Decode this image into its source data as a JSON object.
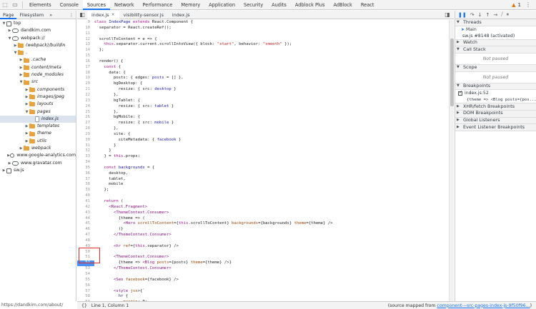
{
  "topbar": {
    "tabs": [
      "Elements",
      "Console",
      "Sources",
      "Network",
      "Performance",
      "Memory",
      "Application",
      "Security",
      "Audits",
      "Adblock Plus",
      "AdBlock",
      "React"
    ],
    "active_tab": "Sources",
    "warning_count": "1"
  },
  "navigator": {
    "tabs": [
      "Page",
      "Filesystem",
      "»"
    ],
    "tree": [
      {
        "label": "top",
        "depth": 0,
        "icon": "square",
        "expanded": true
      },
      {
        "label": "dandkim.com",
        "depth": 1,
        "icon": "cloud",
        "expanded": false
      },
      {
        "label": "webpack://",
        "depth": 1,
        "icon": "cloud",
        "expanded": true
      },
      {
        "label": "(webpack)/buildin",
        "depth": 2,
        "icon": "folder",
        "expanded": false,
        "italic": true
      },
      {
        "label": ".",
        "depth": 2,
        "icon": "folder",
        "expanded": true
      },
      {
        "label": ".cache",
        "depth": 3,
        "icon": "folder",
        "expanded": false,
        "italic": true
      },
      {
        "label": "content/meta",
        "depth": 3,
        "icon": "folder",
        "expanded": false,
        "italic": true
      },
      {
        "label": "node_modules",
        "depth": 3,
        "icon": "folder",
        "expanded": false,
        "italic": true
      },
      {
        "label": "src",
        "depth": 3,
        "icon": "folder",
        "expanded": true,
        "italic": true
      },
      {
        "label": "components",
        "depth": 4,
        "icon": "folder",
        "expanded": false,
        "italic": true
      },
      {
        "label": "images/jpeg",
        "depth": 4,
        "icon": "folder",
        "expanded": false,
        "italic": true
      },
      {
        "label": "layouts",
        "depth": 4,
        "icon": "folder",
        "expanded": false,
        "italic": true
      },
      {
        "label": "pages",
        "depth": 4,
        "icon": "folder",
        "expanded": true,
        "italic": true
      },
      {
        "label": "index.js",
        "depth": 5,
        "icon": "file",
        "selected": true,
        "italic": true
      },
      {
        "label": "templates",
        "depth": 4,
        "icon": "folder",
        "expanded": false,
        "italic": true
      },
      {
        "label": "theme",
        "depth": 4,
        "icon": "folder",
        "expanded": false,
        "italic": true
      },
      {
        "label": "utils",
        "depth": 4,
        "icon": "folder",
        "expanded": false,
        "italic": true
      },
      {
        "label": "webpack",
        "depth": 3,
        "icon": "folder",
        "expanded": false,
        "italic": true
      },
      {
        "label": "www.google-analytics.com",
        "depth": 1,
        "icon": "cloud",
        "expanded": false
      },
      {
        "label": "www.gravatar.com",
        "depth": 1,
        "icon": "cloud",
        "expanded": false
      },
      {
        "label": "sw.js",
        "depth": 0,
        "icon": "square",
        "expanded": false
      }
    ],
    "status_url": "https://dandkim.com/about/"
  },
  "editor": {
    "tabs": [
      {
        "label": "index.js",
        "active": true
      },
      {
        "label": "visibility-sensor.js",
        "active": false
      },
      {
        "label": "index.js",
        "active": false
      }
    ],
    "lines": [
      {
        "n": "9",
        "segs": [
          [
            "kw",
            "class "
          ],
          [
            "ty",
            "IndexPage "
          ],
          [
            "kw",
            "extends "
          ],
          [
            "ct",
            "React.Component {"
          ]
        ]
      },
      {
        "n": "10",
        "segs": [
          [
            "ct",
            "  separator = React.createRef();"
          ]
        ]
      },
      {
        "n": "11",
        "segs": [
          [
            "ct",
            ""
          ]
        ]
      },
      {
        "n": "12",
        "segs": [
          [
            "ct",
            "  scrollToContent = e => {"
          ]
        ]
      },
      {
        "n": "13",
        "segs": [
          [
            "ct",
            "    "
          ],
          [
            "kw",
            "this"
          ],
          [
            "ct",
            ".separator.current.scrollIntoView({ block: "
          ],
          [
            "st",
            "\"start\""
          ],
          [
            "ct",
            ", behavior: "
          ],
          [
            "st",
            "\"smooth\""
          ],
          [
            "ct",
            " });"
          ]
        ]
      },
      {
        "n": "14",
        "segs": [
          [
            "ct",
            "  };"
          ]
        ]
      },
      {
        "n": "15",
        "segs": [
          [
            "ct",
            ""
          ]
        ]
      },
      {
        "n": "16",
        "segs": [
          [
            "ct",
            "  render() {"
          ]
        ]
      },
      {
        "n": "17",
        "segs": [
          [
            "ct",
            "    "
          ],
          [
            "kw",
            "const "
          ],
          [
            "ct",
            "{"
          ]
        ]
      },
      {
        "n": "18",
        "segs": [
          [
            "ct",
            "      data: {"
          ]
        ]
      },
      {
        "n": "19",
        "segs": [
          [
            "ct",
            "        posts: { edges: "
          ],
          [
            "vb",
            "posts"
          ],
          [
            "ct",
            " = [] },"
          ]
        ]
      },
      {
        "n": "20",
        "segs": [
          [
            "ct",
            "        bgDesktop: {"
          ]
        ]
      },
      {
        "n": "21",
        "segs": [
          [
            "ct",
            "          resize: { src: "
          ],
          [
            "vb",
            "desktop"
          ],
          [
            "ct",
            " }"
          ]
        ]
      },
      {
        "n": "22",
        "segs": [
          [
            "ct",
            "        },"
          ]
        ]
      },
      {
        "n": "23",
        "segs": [
          [
            "ct",
            "        bgTablet: {"
          ]
        ]
      },
      {
        "n": "24",
        "segs": [
          [
            "ct",
            "          resize: { src: "
          ],
          [
            "vb",
            "tablet"
          ],
          [
            "ct",
            " }"
          ]
        ]
      },
      {
        "n": "25",
        "segs": [
          [
            "ct",
            "        },"
          ]
        ]
      },
      {
        "n": "26",
        "segs": [
          [
            "ct",
            "        bgMobile: {"
          ]
        ]
      },
      {
        "n": "27",
        "segs": [
          [
            "ct",
            "          resize: { src: "
          ],
          [
            "vb",
            "mobile"
          ],
          [
            "ct",
            " }"
          ]
        ]
      },
      {
        "n": "28",
        "segs": [
          [
            "ct",
            "        },"
          ]
        ]
      },
      {
        "n": "29",
        "segs": [
          [
            "ct",
            "        site: {"
          ]
        ]
      },
      {
        "n": "30",
        "segs": [
          [
            "ct",
            "          siteMetadata: { "
          ],
          [
            "vb",
            "facebook"
          ],
          [
            "ct",
            " }"
          ]
        ]
      },
      {
        "n": "31",
        "segs": [
          [
            "ct",
            "        }"
          ]
        ]
      },
      {
        "n": "32",
        "segs": [
          [
            "ct",
            "      }"
          ]
        ]
      },
      {
        "n": "33",
        "segs": [
          [
            "ct",
            "    } = "
          ],
          [
            "kw",
            "this"
          ],
          [
            "ct",
            ".props;"
          ]
        ]
      },
      {
        "n": "34",
        "segs": [
          [
            "ct",
            ""
          ]
        ]
      },
      {
        "n": "35",
        "segs": [
          [
            "ct",
            "    "
          ],
          [
            "kw",
            "const "
          ],
          [
            "vb",
            "backgrounds"
          ],
          [
            "ct",
            " = {"
          ]
        ]
      },
      {
        "n": "36",
        "segs": [
          [
            "ct",
            "      desktop,"
          ]
        ]
      },
      {
        "n": "37",
        "segs": [
          [
            "ct",
            "      tablet,"
          ]
        ]
      },
      {
        "n": "38",
        "segs": [
          [
            "ct",
            "      mobile"
          ]
        ]
      },
      {
        "n": "39",
        "segs": [
          [
            "ct",
            "    };"
          ]
        ]
      },
      {
        "n": "40",
        "segs": [
          [
            "ct",
            ""
          ]
        ]
      },
      {
        "n": "41",
        "segs": [
          [
            "ct",
            "    "
          ],
          [
            "kw",
            "return "
          ],
          [
            "ct",
            "("
          ]
        ]
      },
      {
        "n": "42",
        "segs": [
          [
            "ct",
            "      "
          ],
          [
            "tg",
            "<React.Fragment>"
          ]
        ]
      },
      {
        "n": "43",
        "segs": [
          [
            "ct",
            "        "
          ],
          [
            "tg",
            "<ThemeContext.Consumer>"
          ]
        ]
      },
      {
        "n": "44",
        "segs": [
          [
            "ct",
            "          {theme => ("
          ]
        ]
      },
      {
        "n": "45",
        "segs": [
          [
            "ct",
            "            "
          ],
          [
            "tg",
            "<Hero "
          ],
          [
            "at",
            "scrollToContent"
          ],
          [
            "ct",
            "={"
          ],
          [
            "kw",
            "this"
          ],
          [
            "ct",
            ".scrollToContent} "
          ],
          [
            "at",
            "backgrounds"
          ],
          [
            "ct",
            "={backgrounds} "
          ],
          [
            "at",
            "theme"
          ],
          [
            "ct",
            "={theme} />"
          ]
        ]
      },
      {
        "n": "46",
        "segs": [
          [
            "ct",
            "          )}"
          ]
        ]
      },
      {
        "n": "47",
        "segs": [
          [
            "ct",
            "        "
          ],
          [
            "tg",
            "</ThemeContext.Consumer>"
          ]
        ]
      },
      {
        "n": "48",
        "segs": [
          [
            "ct",
            ""
          ]
        ]
      },
      {
        "n": "49",
        "segs": [
          [
            "ct",
            "        "
          ],
          [
            "tg",
            "<hr "
          ],
          [
            "at",
            "ref"
          ],
          [
            "ct",
            "={"
          ],
          [
            "kw",
            "this"
          ],
          [
            "ct",
            ".separator} />"
          ]
        ]
      },
      {
        "n": "50",
        "segs": [
          [
            "ct",
            ""
          ]
        ]
      },
      {
        "n": "51",
        "segs": [
          [
            "ct",
            "        "
          ],
          [
            "tg",
            "<ThemeContext.Consumer>"
          ]
        ]
      },
      {
        "n": "52",
        "bp": true,
        "segs": [
          [
            "ct",
            "          {theme => "
          ],
          [
            "tg",
            "<Blog "
          ],
          [
            "at",
            "posts"
          ],
          [
            "ct",
            "={posts} "
          ],
          [
            "at",
            "theme"
          ],
          [
            "ct",
            "={theme} />}"
          ]
        ]
      },
      {
        "n": "53",
        "segs": [
          [
            "ct",
            "        "
          ],
          [
            "tg",
            "</ThemeContext.Consumer>"
          ]
        ]
      },
      {
        "n": "54",
        "segs": [
          [
            "ct",
            ""
          ]
        ]
      },
      {
        "n": "55",
        "segs": [
          [
            "ct",
            "        "
          ],
          [
            "tg",
            "<Seo "
          ],
          [
            "at",
            "facebook"
          ],
          [
            "ct",
            "={facebook} />"
          ]
        ]
      },
      {
        "n": "56",
        "segs": [
          [
            "ct",
            ""
          ]
        ]
      },
      {
        "n": "57",
        "segs": [
          [
            "ct",
            "        "
          ],
          [
            "tg",
            "<style "
          ],
          [
            "at",
            "jsx"
          ],
          [
            "ct",
            ">{`"
          ]
        ]
      },
      {
        "n": "58",
        "segs": [
          [
            "ct",
            "          "
          ],
          [
            "vb",
            "hr"
          ],
          [
            "ct",
            " {"
          ]
        ]
      },
      {
        "n": "59",
        "segs": [
          [
            "ct",
            "            "
          ],
          [
            "at",
            "margin"
          ],
          [
            "ct",
            ": 0;"
          ]
        ]
      },
      {
        "n": "60",
        "segs": [
          [
            "ct",
            "            "
          ],
          [
            "at",
            "border"
          ],
          [
            "ct",
            ": 0;"
          ]
        ]
      }
    ]
  },
  "statusbar": {
    "braces": "{}",
    "position": "Line 1, Column 1",
    "source_prefix": "(source mapped from ",
    "source_link": "component---src-pages-index-js-9f50f96...",
    "source_suffix": ")"
  },
  "debugger": {
    "threads_label": "Threads",
    "threads": [
      "Main",
      "sw.js #8148 (activated)"
    ],
    "panes": [
      "Watch",
      "Call Stack",
      "Scope",
      "Breakpoints",
      "XHR/fetch Breakpoints",
      "DOM Breakpoints",
      "Global Listeners",
      "Event Listener Breakpoints"
    ],
    "not_paused": "Not paused",
    "breakpoint": {
      "location": "index.js:52",
      "code": "{theme => <Blog posts={pos..."
    }
  }
}
